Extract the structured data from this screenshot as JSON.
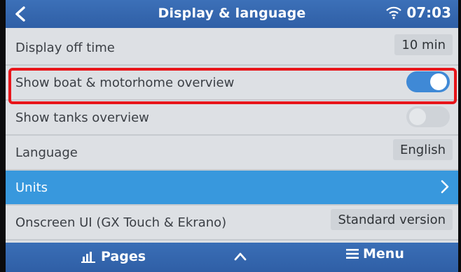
{
  "header": {
    "title": "Display & language",
    "time": "07:03",
    "icons": {
      "back": "chevron-left-icon",
      "wifi": "wifi-icon"
    }
  },
  "settings": {
    "display_off": {
      "label": "Display off time",
      "value": "10 min"
    },
    "boat_overview": {
      "label": "Show boat & motorhome overview",
      "enabled": true
    },
    "tanks_overview": {
      "label": "Show tanks overview",
      "enabled": false
    },
    "language": {
      "label": "Language",
      "value": "English"
    },
    "units": {
      "label": "Units"
    },
    "onscreen_ui": {
      "label": "Onscreen UI (GX Touch & Ekrano)",
      "value": "Standard version"
    }
  },
  "footer": {
    "pages_label": "Pages",
    "menu_label": "Menu",
    "icons": {
      "pages": "bar-chart-icon",
      "up": "chevron-up-icon",
      "menu": "hamburger-icon"
    }
  },
  "colors": {
    "header_blue": "#3c70b8",
    "selected_blue": "#3898dd",
    "toggle_on": "#3f89d6",
    "highlight_red": "#e8151a"
  }
}
